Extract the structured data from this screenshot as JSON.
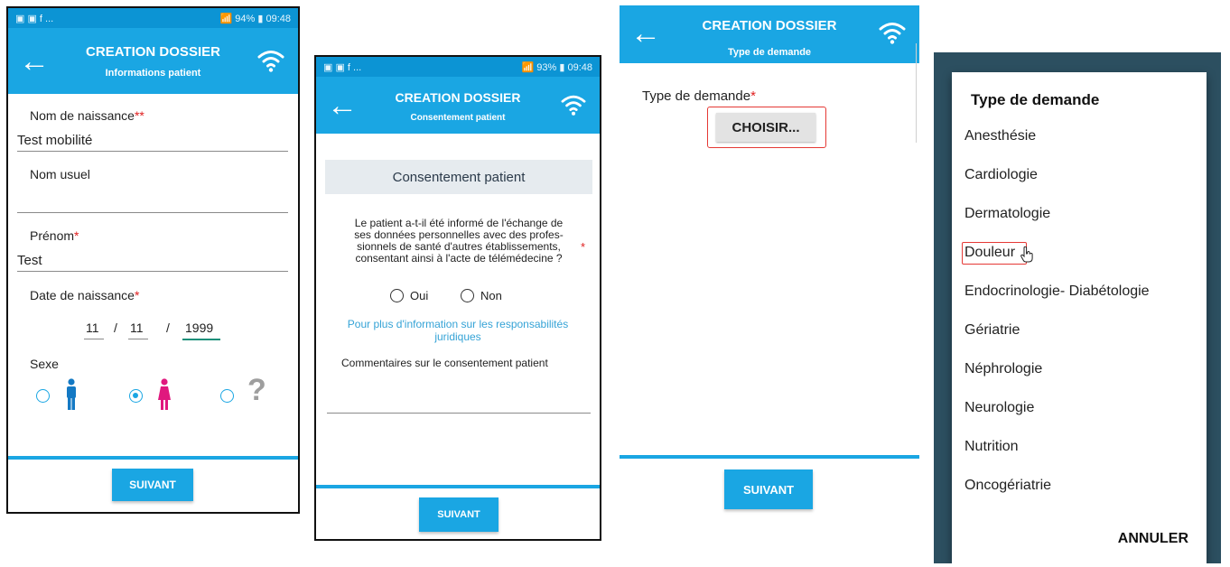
{
  "status_bar_1": {
    "icons": "▣ ▣ f ...",
    "right": "📶 94% ▮ 09:48"
  },
  "status_bar_2": {
    "icons": "▣ ▣ f ...",
    "right": "📶 93% ▮ 09:48"
  },
  "screen1": {
    "title": "CREATION DOSSIER",
    "subtitle": "Informations patient",
    "nom_naissance_label": "Nom de naissance",
    "nom_naissance_req": "**",
    "nom_naissance_value": "Test mobilité",
    "nom_usuel_label": "Nom usuel",
    "nom_usuel_value": "",
    "prenom_label": "Prénom",
    "prenom_req": "*",
    "prenom_value": "Test",
    "date_label": "Date de naissance",
    "date_req": "*",
    "date_day": "11",
    "date_month": "11",
    "date_year": "1999",
    "date_sep": "/",
    "sexe_label": "Sexe",
    "sexe_selected": "female",
    "unknown_symbol": "?",
    "next_button": "SUIVANT"
  },
  "screen2": {
    "title": "CREATION DOSSIER",
    "subtitle": "Consentement patient",
    "section_header": "Consentement patient",
    "question_lines": [
      "Le patient a-t-il été informé de l'échange de",
      "ses données personnelles avec des profes-",
      "sionnels de santé d'autres établissements,",
      "consentant ainsi à l'acte de télémédecine ?"
    ],
    "question_req": "*",
    "option_yes": "Oui",
    "option_no": "Non",
    "info_link_line1": "Pour plus d'information sur les responsabilités",
    "info_link_line2": "juridiques",
    "comment_label": "Commentaires sur le consentement patient",
    "comment_value": "",
    "next_button": "SUIVANT"
  },
  "screen3": {
    "title": "CREATION DOSSIER",
    "subtitle": "Type de demande",
    "type_label": "Type de demande",
    "type_req": "*",
    "choose_button": "CHOISIR...",
    "next_button": "SUIVANT"
  },
  "screen4": {
    "dialog_title": "Type de demande",
    "options": [
      "Anesthésie",
      "Cardiologie",
      "Dermatologie",
      "Douleur",
      "Endocrinologie- Diabétologie",
      "Gériatrie",
      "Néphrologie",
      "Neurologie",
      "Nutrition",
      "Oncogériatrie"
    ],
    "highlighted_option": "Douleur",
    "cancel_button": "ANNULER"
  },
  "colors": {
    "app_bar": "#1aa6e3",
    "status_bar": "#0c94d4",
    "male_icon": "#1479c4",
    "female_icon": "#e0187e",
    "required": "#e02020",
    "highlight_box": "#e53935",
    "link": "#35a3d6"
  }
}
